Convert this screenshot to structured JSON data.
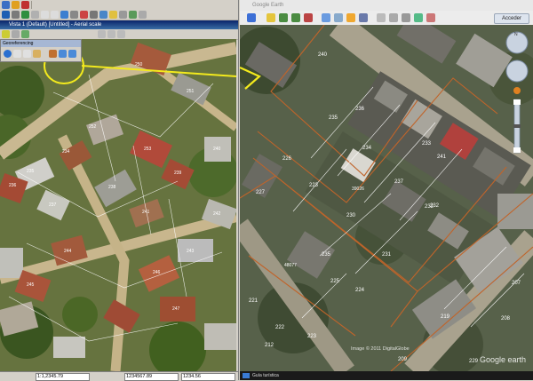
{
  "left_window": {
    "title": "Vista 1 (Default) [Untitled] - Aerial scale",
    "panel_title": "Georeferencing",
    "status_fields": [
      "1:1,2345.79",
      "1234567.89",
      "1234.56"
    ]
  },
  "left_parcels": [
    {
      "label": "250"
    },
    {
      "label": "251"
    },
    {
      "label": "252"
    },
    {
      "label": "253"
    },
    {
      "label": "234"
    },
    {
      "label": "235"
    },
    {
      "label": "236"
    },
    {
      "label": "237"
    },
    {
      "label": "238"
    },
    {
      "label": "239"
    },
    {
      "label": "240"
    },
    {
      "label": "241"
    },
    {
      "label": "242"
    },
    {
      "label": "243"
    },
    {
      "label": "244"
    },
    {
      "label": "245"
    },
    {
      "label": "246"
    },
    {
      "label": "247"
    }
  ],
  "ge_window": {
    "title": "Google Earth",
    "login_label": "Acceder"
  },
  "ge_parcels": [
    {
      "label": "240"
    },
    {
      "label": "235"
    },
    {
      "label": "236"
    },
    {
      "label": "233"
    },
    {
      "label": "234"
    },
    {
      "label": "226"
    },
    {
      "label": "223"
    },
    {
      "label": "230"
    },
    {
      "label": "231"
    },
    {
      "label": "232"
    },
    {
      "label": "235"
    },
    {
      "label": "224"
    },
    {
      "label": "221"
    },
    {
      "label": "222"
    },
    {
      "label": "223"
    },
    {
      "label": "212"
    },
    {
      "label": "207"
    },
    {
      "label": "208"
    },
    {
      "label": "209"
    },
    {
      "label": "219"
    },
    {
      "label": "237"
    },
    {
      "label": "227"
    },
    {
      "label": "225"
    },
    {
      "label": "241"
    },
    {
      "label": "229"
    },
    {
      "label": "232"
    }
  ],
  "ge_point_labels": [
    "39026",
    "48077"
  ],
  "ge_status": {
    "tour_label": "Guía turística",
    "copyright": "Image © 2011 DigitalGlobe",
    "google_logo": "Google earth"
  },
  "colors": {
    "parcel_line": "#c0642a",
    "highlight": "#f3ea1d",
    "title_bar": "#0a246a"
  }
}
